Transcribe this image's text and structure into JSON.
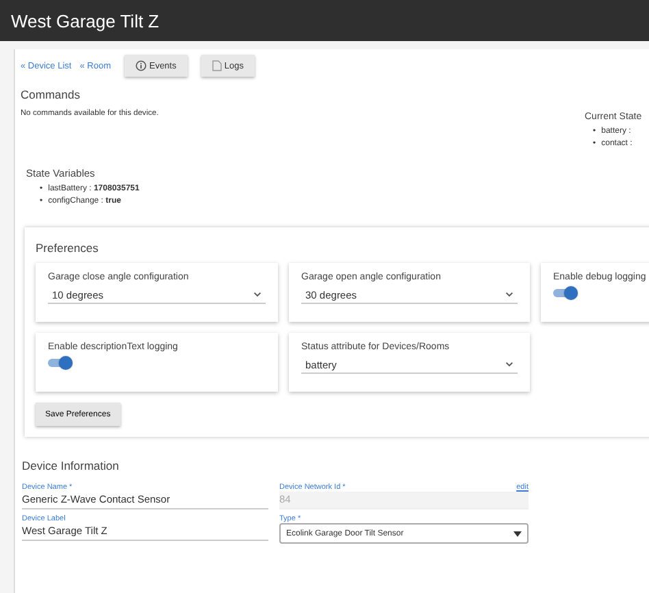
{
  "header": {
    "title": "West Garage Tilt Z"
  },
  "nav": {
    "links": [
      "« Device List",
      "« Room"
    ],
    "buttons": [
      {
        "label": "Events"
      },
      {
        "label": "Logs"
      }
    ]
  },
  "commands": {
    "title": "Commands",
    "message": "No commands available for this device."
  },
  "current_states": {
    "title": "Current State",
    "items": [
      {
        "bullet": "•",
        "text": "battery :"
      },
      {
        "bullet": "•",
        "text": "contact :"
      }
    ]
  },
  "state_variables": {
    "title": "State Variables",
    "items": [
      {
        "bullet": "•",
        "name": "lastBattery : ",
        "value": "1708035751"
      },
      {
        "bullet": "•",
        "name": "configChange : ",
        "value": "true"
      }
    ]
  },
  "preferences": {
    "title": "Preferences",
    "items": [
      {
        "kind": "select",
        "label": "Garage close angle configuration",
        "value": "10 degrees"
      },
      {
        "kind": "select",
        "label": "Garage open angle configuration",
        "value": "30 degrees"
      },
      {
        "kind": "toggle",
        "label": "Enable debug logging",
        "on": true
      },
      {
        "kind": "toggle",
        "label": "Enable descriptionText logging",
        "on": true
      },
      {
        "kind": "select",
        "label": "Status attribute for Devices/Rooms",
        "value": "battery"
      }
    ],
    "save_button": "Save Preferences"
  },
  "device_information": {
    "title": "Device Information",
    "fields": [
      {
        "kind": "text",
        "label": "Device Name *",
        "value": "Generic Z-Wave Contact Sensor"
      },
      {
        "kind": "text",
        "label": "Device Network Id *",
        "value": "84",
        "disabled": true,
        "edit_link": "edit"
      },
      {
        "kind": "text",
        "label": "Device Label",
        "value": "West Garage Tilt Z"
      },
      {
        "kind": "select",
        "label": "Type *",
        "value": "Ecolink Garage Door Tilt Sensor"
      }
    ]
  }
}
